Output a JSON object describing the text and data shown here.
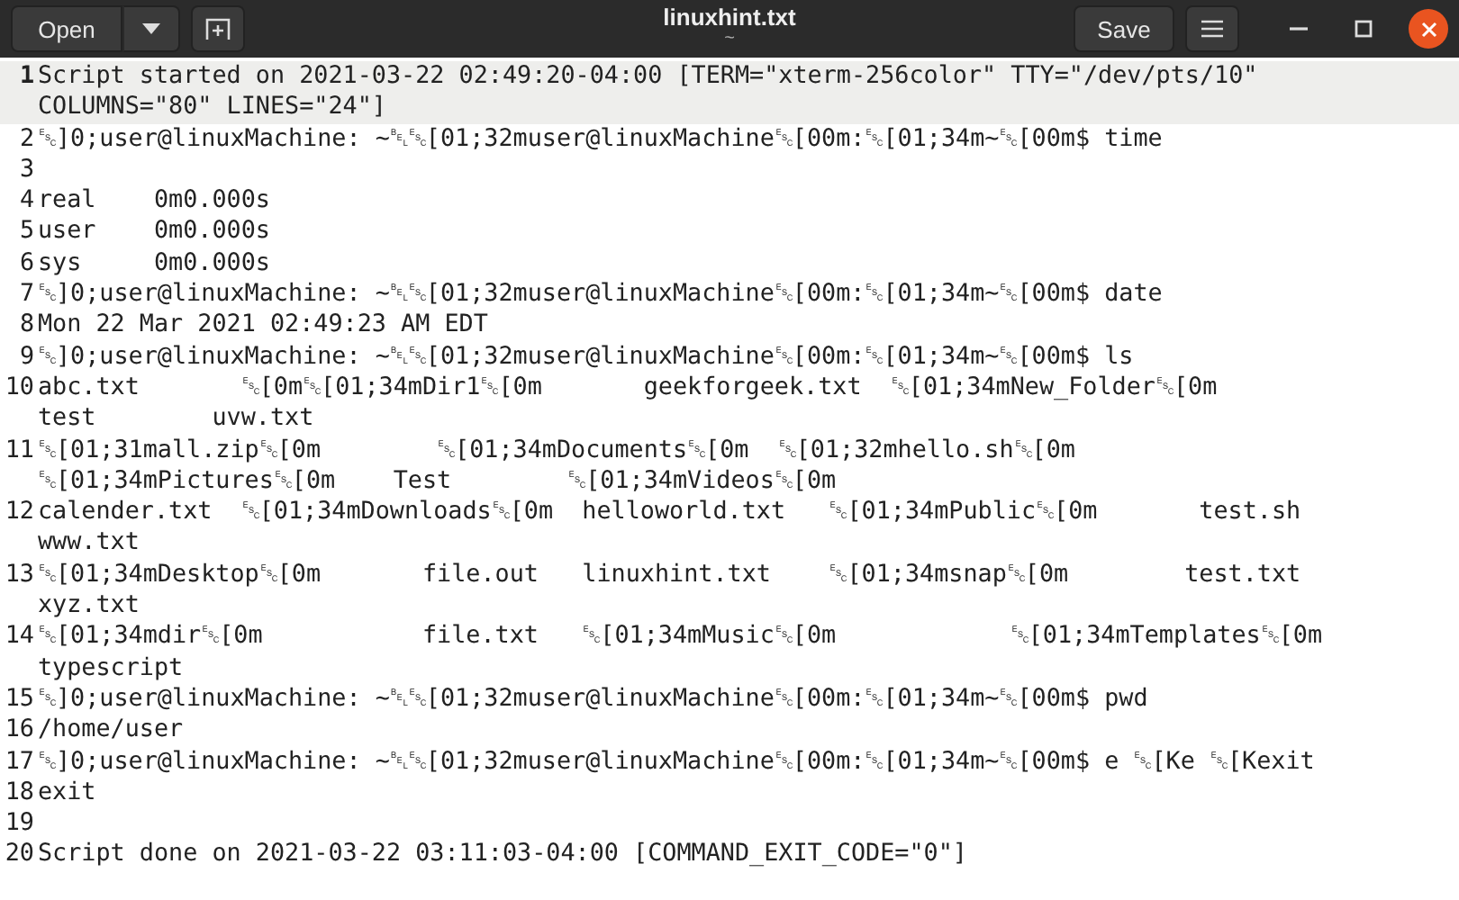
{
  "window": {
    "title": "linuxhint.txt",
    "subtitle": "~"
  },
  "toolbar": {
    "open": "Open",
    "save": "Save"
  },
  "lines": [
    {
      "number": "1",
      "current": true,
      "rows": [
        "Script started on 2021-03-22 02:49:20-04:00 [TERM=\"xterm-256color\" TTY=\"/dev/pts/10\"",
        "COLUMNS=\"80\" LINES=\"24\"]"
      ]
    },
    {
      "number": "2",
      "current": false,
      "rows": [
        "␛]0;user@linuxMachine: ~␇␛[01;32muser@linuxMachine␛[00m:␛[01;34m~␛[00m$ time"
      ]
    },
    {
      "number": "3",
      "current": false,
      "rows": [
        ""
      ]
    },
    {
      "number": "4",
      "current": false,
      "rows": [
        "real    0m0.000s"
      ]
    },
    {
      "number": "5",
      "current": false,
      "rows": [
        "user    0m0.000s"
      ]
    },
    {
      "number": "6",
      "current": false,
      "rows": [
        "sys     0m0.000s"
      ]
    },
    {
      "number": "7",
      "current": false,
      "rows": [
        "␛]0;user@linuxMachine: ~␇␛[01;32muser@linuxMachine␛[00m:␛[01;34m~␛[00m$ date"
      ]
    },
    {
      "number": "8",
      "current": false,
      "rows": [
        "Mon 22 Mar 2021 02:49:23 AM EDT"
      ]
    },
    {
      "number": "9",
      "current": false,
      "rows": [
        "␛]0;user@linuxMachine: ~␇␛[01;32muser@linuxMachine␛[00m:␛[01;34m~␛[00m$ ls"
      ]
    },
    {
      "number": "10",
      "current": false,
      "rows": [
        "abc.txt       ␛[0m␛[01;34mDir1␛[0m       geekforgeek.txt  ␛[01;34mNew_Folder␛[0m",
        "test        uvw.txt"
      ]
    },
    {
      "number": "11",
      "current": false,
      "rows": [
        "␛[01;31mall.zip␛[0m        ␛[01;34mDocuments␛[0m  ␛[01;32mhello.sh␛[0m",
        "␛[01;34mPictures␛[0m    Test        ␛[01;34mVideos␛[0m"
      ]
    },
    {
      "number": "12",
      "current": false,
      "rows": [
        "calender.txt  ␛[01;34mDownloads␛[0m  helloworld.txt   ␛[01;34mPublic␛[0m       test.sh",
        "www.txt"
      ]
    },
    {
      "number": "13",
      "current": false,
      "rows": [
        "␛[01;34mDesktop␛[0m       file.out   linuxhint.txt    ␛[01;34msnap␛[0m        test.txt",
        "xyz.txt"
      ]
    },
    {
      "number": "14",
      "current": false,
      "rows": [
        "␛[01;34mdir␛[0m           file.txt   ␛[01;34mMusic␛[0m            ␛[01;34mTemplates␛[0m",
        "typescript"
      ]
    },
    {
      "number": "15",
      "current": false,
      "rows": [
        "␛]0;user@linuxMachine: ~␇␛[01;32muser@linuxMachine␛[00m:␛[01;34m~␛[00m$ pwd"
      ]
    },
    {
      "number": "16",
      "current": false,
      "rows": [
        "/home/user"
      ]
    },
    {
      "number": "17",
      "current": false,
      "rows": [
        "␛]0;user@linuxMachine: ~␇␛[01;32muser@linuxMachine␛[00m:␛[01;34m~␛[00m$ e ␛[Ke ␛[Kexit"
      ]
    },
    {
      "number": "18",
      "current": false,
      "rows": [
        "exit"
      ]
    },
    {
      "number": "19",
      "current": false,
      "rows": [
        ""
      ]
    },
    {
      "number": "20",
      "current": false,
      "rows": [
        "Script done on 2021-03-22 03:11:03-04:00 [COMMAND_EXIT_CODE=\"0\"]"
      ]
    }
  ]
}
